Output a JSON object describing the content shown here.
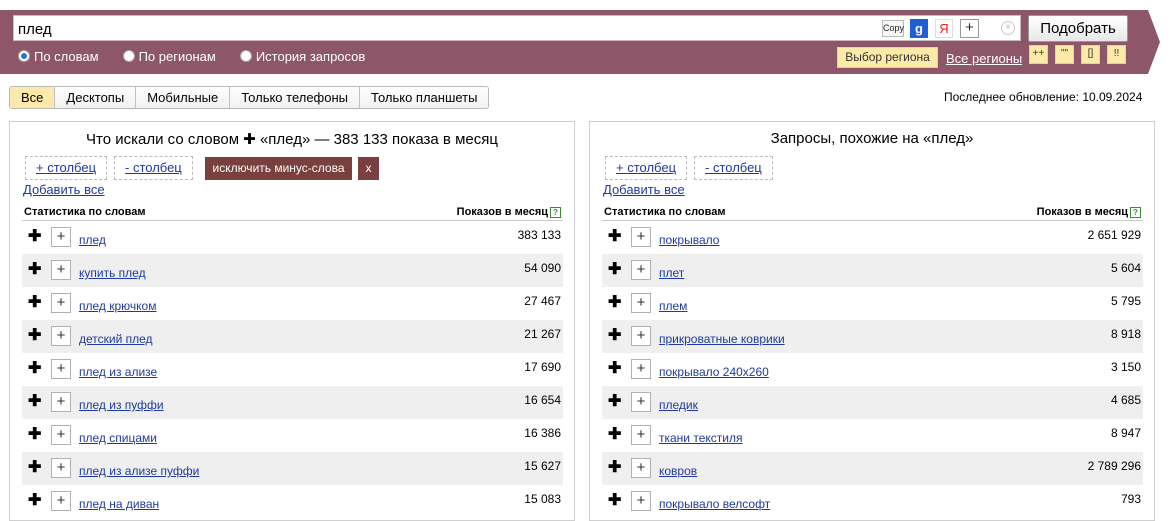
{
  "search": {
    "query": "плед",
    "copy_label": "Copy",
    "google_label": "g",
    "yandex_label": "Я",
    "add_label": "+",
    "clear_label": "×",
    "submit_label": "Подобрать"
  },
  "modes": [
    {
      "label": "По словам",
      "selected": true
    },
    {
      "label": "По регионам",
      "selected": false
    },
    {
      "label": "История запросов",
      "selected": false
    }
  ],
  "region": {
    "choose_label": "Выбор региона",
    "all_regions_label": "Все регионы"
  },
  "operators": [
    "++",
    "\"\"",
    "[]",
    "!!"
  ],
  "device_tabs": [
    {
      "label": "Все",
      "active": true
    },
    {
      "label": "Десктопы",
      "active": false
    },
    {
      "label": "Мобильные",
      "active": false
    },
    {
      "label": "Только телефоны",
      "active": false
    },
    {
      "label": "Только планшеты",
      "active": false
    }
  ],
  "last_update": "Последнее обновление: 10.09.2024",
  "left_panel": {
    "title": "Что искали со словом  ✚ «плед» — 383 133 показа в месяц",
    "add_column": "+ столбец",
    "remove_column": "- столбец",
    "exclude_minus": "исключить минус-слова",
    "exclude_close": "x",
    "add_all": "Добавить все",
    "col_phrase": "Статистика по словам",
    "col_count": "Показов в месяц",
    "rows": [
      {
        "phrase": "плед",
        "count": "383 133"
      },
      {
        "phrase": "купить плед",
        "count": "54 090"
      },
      {
        "phrase": "плед крючком",
        "count": "27 467"
      },
      {
        "phrase": "детский плед",
        "count": "21 267"
      },
      {
        "phrase": "плед из ализе",
        "count": "17 690"
      },
      {
        "phrase": "плед из пуффи",
        "count": "16 654"
      },
      {
        "phrase": "плед спицами",
        "count": "16 386"
      },
      {
        "phrase": "плед из ализе пуффи",
        "count": "15 627"
      },
      {
        "phrase": "плед на диван",
        "count": "15 083"
      }
    ]
  },
  "right_panel": {
    "title": "Запросы, похожие на «плед»",
    "add_column": "+ столбец",
    "remove_column": "- столбец",
    "add_all": "Добавить все",
    "col_phrase": "Статистика по словам",
    "col_count": "Показов в месяц",
    "rows": [
      {
        "phrase": "покрывало",
        "count": "2 651 929"
      },
      {
        "phrase": "плет",
        "count": "5 604"
      },
      {
        "phrase": "плем",
        "count": "5 795"
      },
      {
        "phrase": "прикроватные коврики",
        "count": "8 918"
      },
      {
        "phrase": "покрывало 240х260",
        "count": "3 150"
      },
      {
        "phrase": "пледик",
        "count": "4 685"
      },
      {
        "phrase": "ткани текстиля",
        "count": "8 947"
      },
      {
        "phrase": "ковров",
        "count": "2 789 296"
      },
      {
        "phrase": "покрывало велсофт",
        "count": "793"
      }
    ]
  },
  "colors": {
    "header_band": "#8e5769",
    "accent_yellow": "#fdeaa8",
    "link_blue": "#1e3a9e",
    "exclude_bg": "#7a3f3f",
    "row_alt": "#efefef"
  }
}
